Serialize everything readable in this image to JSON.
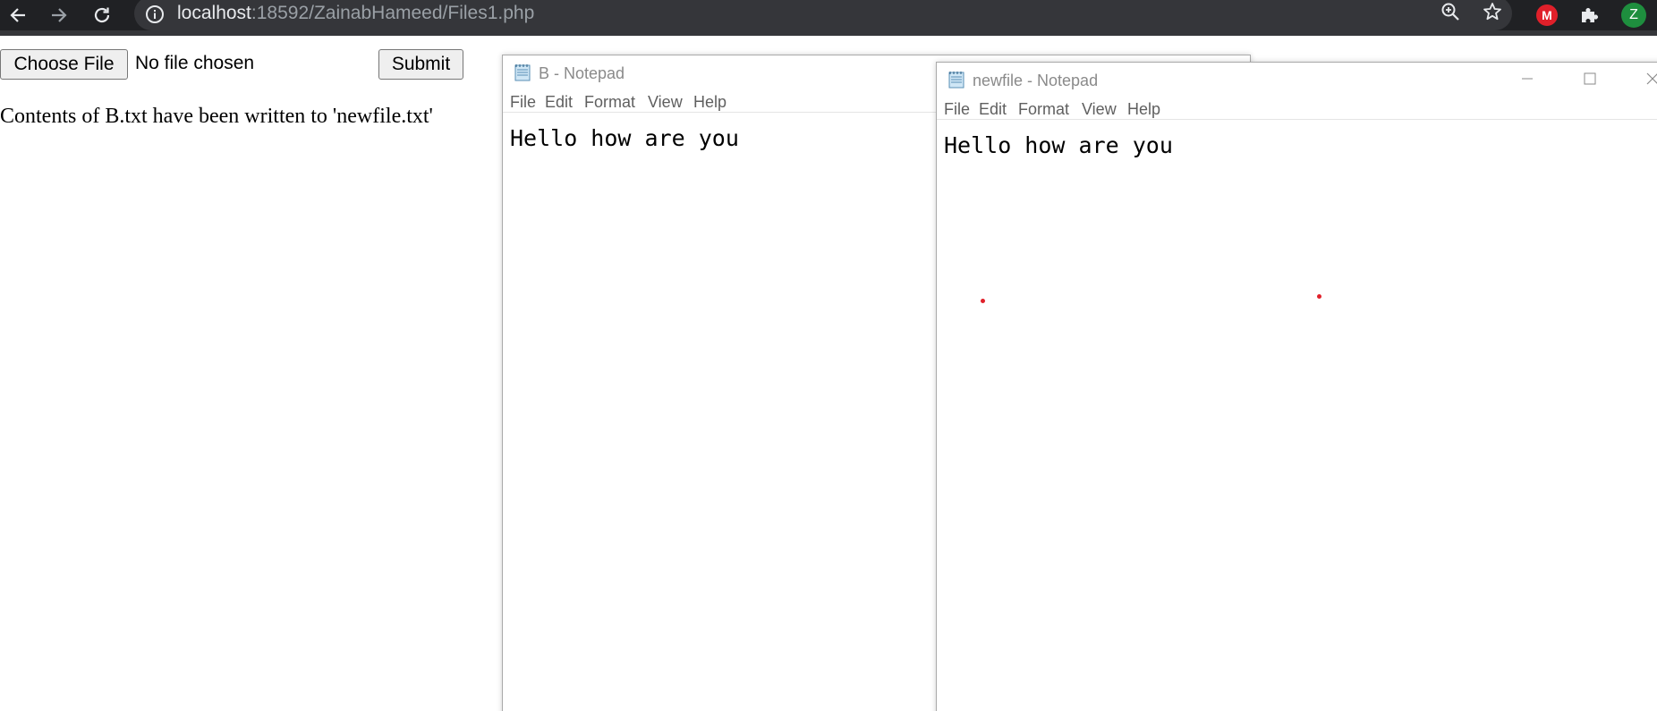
{
  "browser": {
    "url_host": "localhost",
    "url_rest": ":18592/ZainabHameed/Files1.php",
    "extension_m_label": "M",
    "profile_initial": "Z",
    "colors": {
      "toolbar": "#202124",
      "omnibox": "#35363a",
      "profile": "#1e8e3e",
      "extension": "#e0202a"
    },
    "icons": [
      "back-arrow-icon",
      "forward-arrow-icon",
      "reload-icon",
      "info-icon",
      "zoom-icon",
      "star-icon",
      "extensions-puzzle-icon"
    ]
  },
  "form": {
    "choose_file_label": "Choose File",
    "no_file_text": "No file chosen",
    "submit_label": "Submit"
  },
  "result_message": "Contents of B.txt have been written to 'newfile.txt'",
  "notepad_b": {
    "title": "B - Notepad",
    "menu": [
      "File",
      "Edit",
      "Format",
      "View",
      "Help"
    ],
    "content": "Hello how are you"
  },
  "notepad_newfile": {
    "title": "newfile - Notepad",
    "menu": [
      "File",
      "Edit",
      "Format",
      "View",
      "Help"
    ],
    "content": "Hello how are you"
  }
}
